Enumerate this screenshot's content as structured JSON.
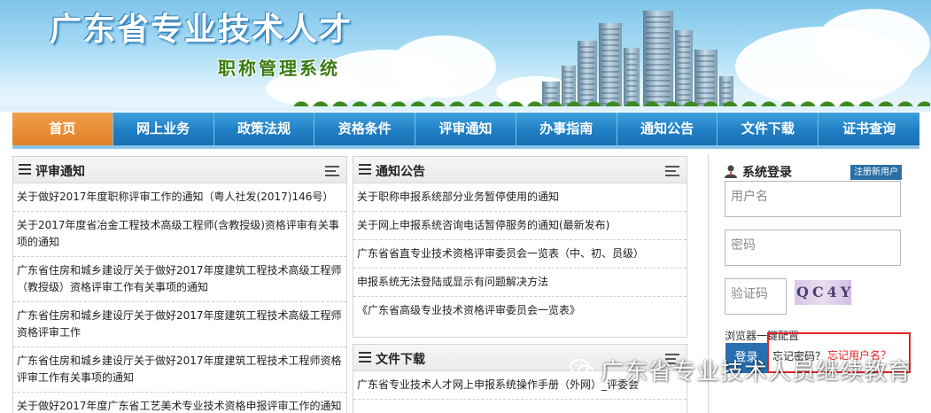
{
  "banner": {
    "title": "广东省专业技术人才",
    "subtitle": "职称管理系统"
  },
  "nav": {
    "items": [
      "首页",
      "网上业务",
      "政策法规",
      "资格条件",
      "评审通知",
      "办事指南",
      "通知公告",
      "文件下载",
      "证书查询"
    ],
    "active": 0
  },
  "review_notice": {
    "title": "评审通知",
    "items": [
      "关于做好2017年度职称评审工作的通知（粤人社发(2017)146号）",
      "关于2017年度省冶金工程技术高级工程师(含教授级)资格评审有关事项的通知",
      "广东省住房和城乡建设厅关于做好2017年度建筑工程技术高级工程师（教授级）资格评审工作有关事项的通知",
      "广东省住房和城乡建设厅关于做好2017年度建筑工程技术高级工程师资格评审工作",
      "广东省住房和城乡建设厅关于做好2017年度建筑工程技术工程师资格评审工作有关事项的通知",
      "关于做好2017年度广东省工艺美术专业技术资格申报评审工作的通知"
    ]
  },
  "announcements": {
    "title": "通知公告",
    "items": [
      "关于职称申报系统部分业务暂停使用的通知",
      "关于网上申报系统咨询电话暂停服务的通知(最新发布)",
      "广东省省直专业技术资格评审委员会一览表（中、初、员级）",
      "申报系统无法登陆或显示有问题解决方法",
      "《广东省高级专业技术资格评审委员会一览表》"
    ]
  },
  "downloads": {
    "title": "文件下载",
    "items": [
      "广东省专业技术人才网上申报系统操作手册（外网）_评委会"
    ]
  },
  "login": {
    "title": "系统登录",
    "register_label": "注册新用户",
    "username_placeholder": "用户名",
    "password_placeholder": "密码",
    "captcha_placeholder": "验证码",
    "captcha_text": "QC4Y",
    "browser_note": "浏览器一键配置",
    "login_label": "登录",
    "forgot_password": "忘记密码？",
    "forgot_username": "忘记用户名？",
    "highlight_color": "#e0242a"
  },
  "watermark": {
    "text": "广东省专业技术人员继续教育",
    "icon": "wechat-icon"
  },
  "colors": {
    "nav_blue": "#1f7fc4",
    "nav_active": "#e17f27",
    "accent_red": "#e0242a"
  }
}
